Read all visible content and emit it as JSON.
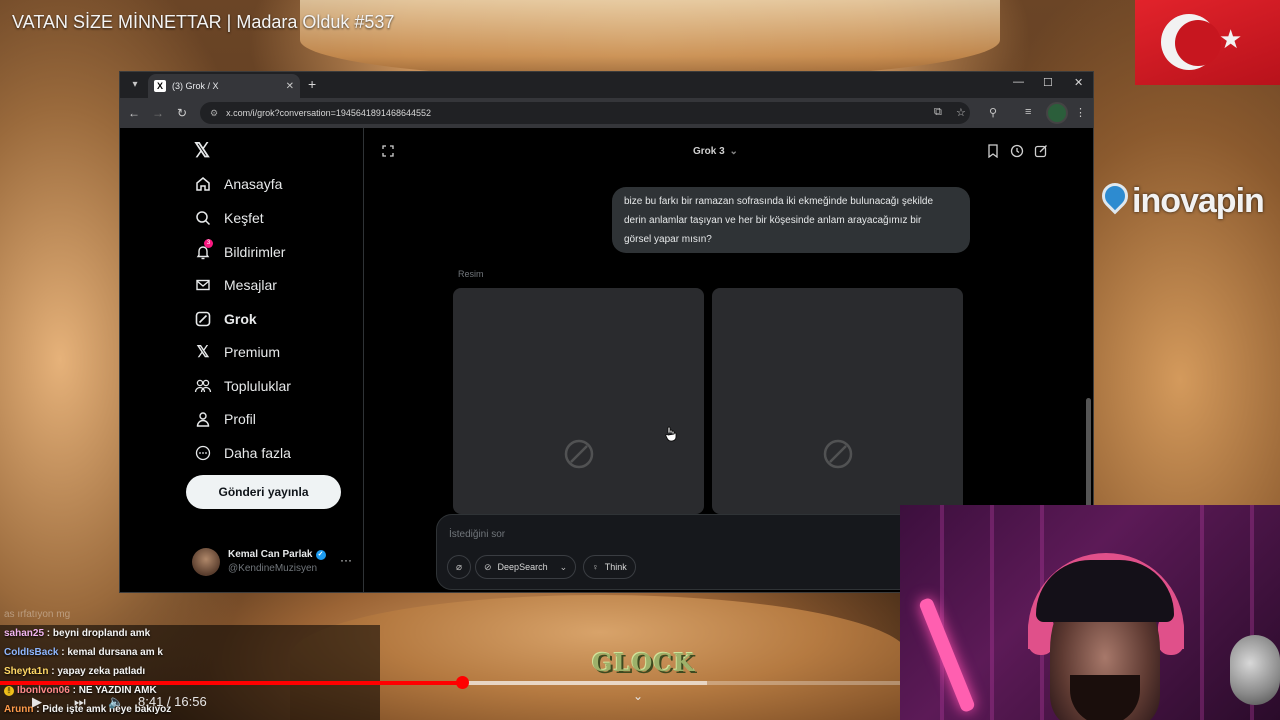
{
  "video": {
    "title": "VATAN SİZE MİNNETTAR | Madara Olduk #537",
    "sponsor": "inovapin",
    "overlay_logo": "GLOCK",
    "time_current": "8:41",
    "time_total": "16:56",
    "time_sep": " / ",
    "progress_fraction": 0.513
  },
  "browser": {
    "tab_title": "(3) Grok / X",
    "url": "x.com/i/grok?conversation=1945641891468644552"
  },
  "x": {
    "nav": [
      {
        "label": "Anasayfa",
        "icon": "home-icon"
      },
      {
        "label": "Keşfet",
        "icon": "search-icon"
      },
      {
        "label": "Bildirimler",
        "icon": "bell-icon",
        "badge": "3"
      },
      {
        "label": "Mesajlar",
        "icon": "mail-icon"
      },
      {
        "label": "Grok",
        "icon": "grok-icon"
      },
      {
        "label": "Premium",
        "icon": "x-icon"
      },
      {
        "label": "Topluluklar",
        "icon": "people-icon"
      },
      {
        "label": "Profil",
        "icon": "person-icon"
      },
      {
        "label": "Daha fazla",
        "icon": "more-circle-icon"
      }
    ],
    "post_button": "Gönderi yayınla",
    "user": {
      "name": "Kemal Can Parlak",
      "handle": "@KendineMuzisyen"
    }
  },
  "grok": {
    "model": "Grok 3",
    "user_message_lines": [
      "bize bu farkı bir ramazan sofrasında iki ekmeğinde bulunacağı şekilde",
      "derin anlamlar taşıyan ve her bir köşesinde anlam arayacağımız bir",
      "görsel yapar mısın?"
    ],
    "section_label": "Resim",
    "composer_placeholder": "İstediğini sor",
    "chips": {
      "deepsearch": "DeepSearch",
      "think": "Think"
    }
  },
  "chat": [
    {
      "user": "sahan25",
      "message": "beyni droplandı amk",
      "color": "#f2b5f0"
    },
    {
      "user": "ColdIsBack",
      "message": "kemal dursana am k",
      "color": "#8fb7ff"
    },
    {
      "user": "Sheyta1n",
      "message": "yapay zeka patladı",
      "color": "#ffd866"
    },
    {
      "user": "Ibonlvon06",
      "message": "NE YAZDIN AMK",
      "color": "#ff8a8a"
    },
    {
      "user": "Arunn",
      "message": "Pide işte amk neye bakıyoz",
      "color": "#ff9b4a"
    }
  ],
  "chat_faded": "as ırfatıyon mg",
  "colors": {
    "accent_red": "#ff0000",
    "x_blue": "#1d9bf0",
    "notif_pink": "#f91880"
  }
}
